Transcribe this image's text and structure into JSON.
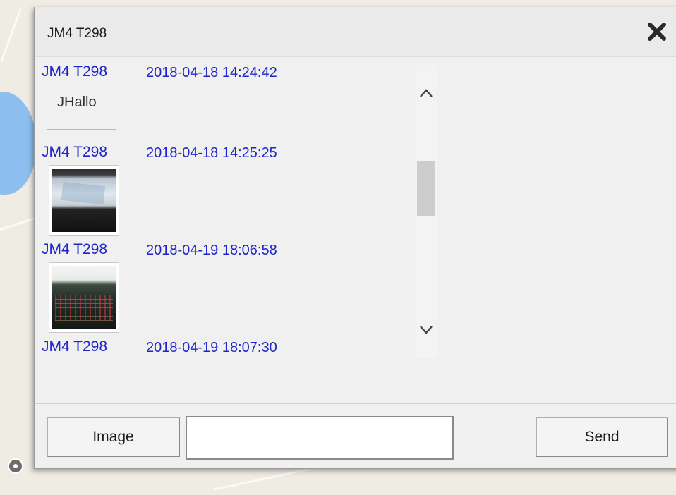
{
  "dialog": {
    "title": "JM4 T298",
    "close_icon": "close-x-icon"
  },
  "messages": [
    {
      "sender": "JM4 T298",
      "time": "2018-04-18 14:24:42",
      "type": "text",
      "text": "JHallo"
    },
    {
      "sender": "JM4 T298",
      "time": "2018-04-18 14:25:25",
      "type": "image"
    },
    {
      "sender": "JM4 T298",
      "time": "2018-04-19 18:06:58",
      "type": "image"
    },
    {
      "sender": "JM4 T298",
      "time": "2018-04-19 18:07:30",
      "type": "text",
      "text": ""
    }
  ],
  "scrollbar": {
    "up_icon": "chevron-up-icon",
    "down_icon": "chevron-down-icon"
  },
  "footer": {
    "image_button_label": "Image",
    "message_value": "",
    "send_button_label": "Send"
  },
  "colors": {
    "sender_color": "#1f24c9",
    "dialog_background": "#f0f0f0"
  }
}
